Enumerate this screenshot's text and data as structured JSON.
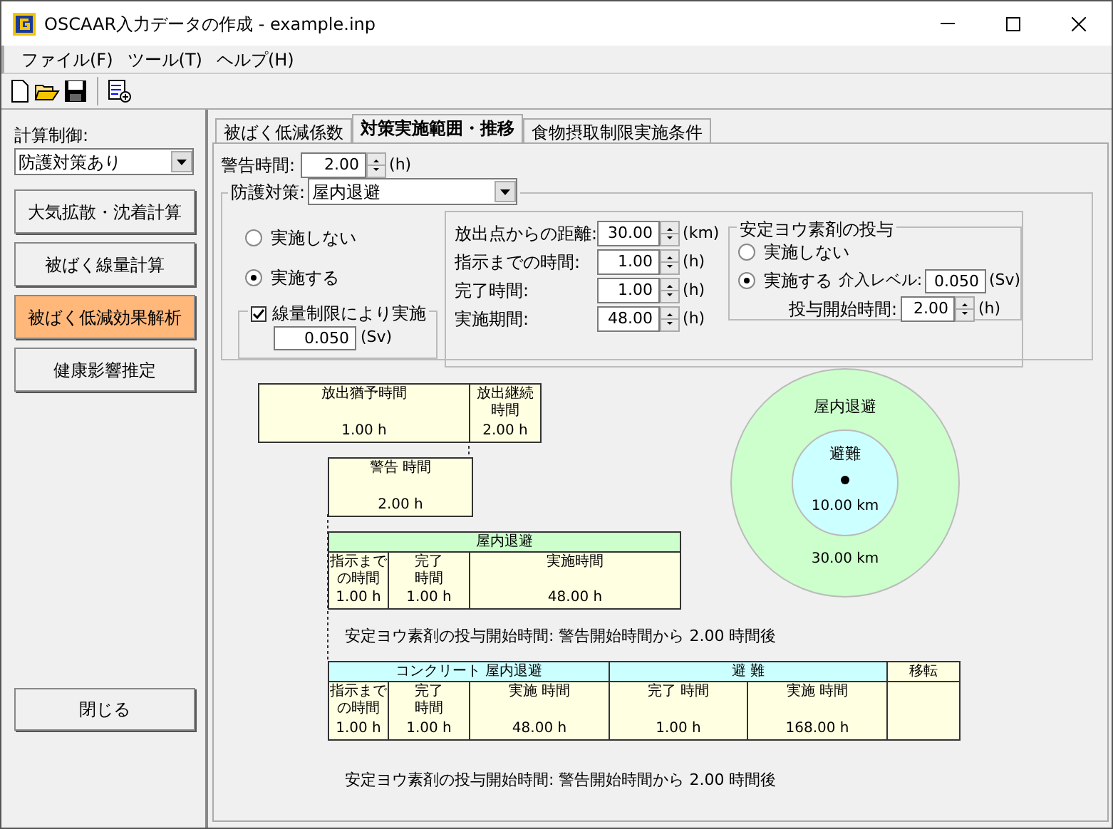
{
  "window": {
    "title": "OSCAAR入力データの作成 - example.inp"
  },
  "menu": [
    "ファイル(F)",
    "ツール(T)",
    "ヘルプ(H)"
  ],
  "sidebar": {
    "label": "計算制御:",
    "select": "防護対策あり",
    "buttons": [
      {
        "label": "大気拡散・沈着計算",
        "selected": false
      },
      {
        "label": "被ばく線量計算",
        "selected": false
      },
      {
        "label": "被ばく低減効果解析",
        "selected": true
      },
      {
        "label": "健康影響推定",
        "selected": false
      }
    ],
    "close": "閉じる"
  },
  "tabs": [
    {
      "label": "被ばく低減係数",
      "selected": false
    },
    {
      "label": "対策実施範囲・推移",
      "selected": true
    },
    {
      "label": "食物摂取制限実施条件",
      "selected": false
    }
  ],
  "warning": {
    "label": "警告時間:",
    "value": "2.00",
    "unit": "(h)"
  },
  "countermeasure": {
    "label": "防護対策:",
    "select": "屋内退避",
    "options": [
      {
        "label": "実施しない",
        "selected": false
      },
      {
        "label": "実施する",
        "selected": true
      }
    ],
    "dose_limit": {
      "label": "線量制限により実施",
      "checked": true,
      "value": "0.050",
      "unit": "(Sv)"
    },
    "fields": [
      {
        "label": "放出点からの距離:",
        "value": "30.00",
        "unit": "(km)"
      },
      {
        "label": "指示までの時間:",
        "value": "1.00",
        "unit": "(h)"
      },
      {
        "label": "完了時間:",
        "value": "1.00",
        "unit": "(h)"
      },
      {
        "label": "実施期間:",
        "value": "48.00",
        "unit": "(h)"
      }
    ],
    "iodine": {
      "title": "安定ヨウ素剤の投与",
      "options": [
        {
          "label": "実施しない",
          "selected": false
        },
        {
          "label": "実施する",
          "selected": true
        }
      ],
      "intervention": {
        "label": "介入レベル:",
        "value": "0.050",
        "unit": "(Sv)"
      },
      "start": {
        "label": "投与開始時間:",
        "value": "2.00",
        "unit": "(h)"
      }
    }
  },
  "diagram": {
    "boxes": [
      {
        "cells": [
          {
            "lines": [
              "放出猶予時間"
            ],
            "value": "1.00 h"
          },
          {
            "lines": [
              "放出継続",
              "時間"
            ],
            "value": "2.00 h"
          }
        ]
      },
      {
        "cells": [
          {
            "lines": [
              "警告 時間"
            ],
            "value": "2.00 h"
          }
        ]
      },
      {
        "header": [
          {
            "label": "屋内退避",
            "color": "#ccffcc"
          }
        ],
        "cells": [
          {
            "lines": [
              "指示まで",
              "の時間"
            ],
            "value": "1.00 h"
          },
          {
            "lines": [
              "完了",
              "時間"
            ],
            "value": "1.00 h"
          },
          {
            "lines": [
              "実施時間"
            ],
            "value": "48.00 h"
          }
        ]
      },
      {
        "header": [
          {
            "label": "コンクリート 屋内退避",
            "color": "#ccffff"
          },
          {
            "label": "避 難",
            "color": "#ccffff"
          },
          {
            "label": "移転",
            "color": "#ffffe1"
          }
        ],
        "cells": [
          {
            "lines": [
              "指示まで",
              "の時間"
            ],
            "value": "1.00 h"
          },
          {
            "lines": [
              "完了",
              "時間"
            ],
            "value": "1.00 h"
          },
          {
            "lines": [
              "実施 時間"
            ],
            "value": "48.00 h"
          },
          {
            "lines": [
              "完了 時間"
            ],
            "value": "1.00 h"
          },
          {
            "lines": [
              "実施 時間"
            ],
            "value": "168.00 h"
          },
          {}
        ]
      }
    ],
    "notes": [
      "安定ヨウ素剤の投与開始時間: 警告開始時間から 2.00 時間後",
      "安定ヨウ素剤の投与開始時間: 警告開始時間から 2.00 時間後"
    ],
    "zones": [
      {
        "label": "屋内退避",
        "color": "#ccffcc"
      },
      {
        "label": "避難",
        "color": "#ccffff"
      }
    ],
    "distances": [
      "10.00 km",
      "30.00 km"
    ]
  }
}
